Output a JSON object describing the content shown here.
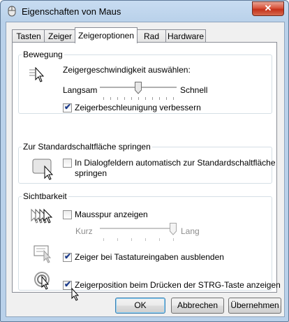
{
  "window": {
    "title": "Eigenschaften von Maus",
    "close_label": "✕"
  },
  "tabs": [
    {
      "label": "Tasten",
      "active": false
    },
    {
      "label": "Zeiger",
      "active": false
    },
    {
      "label": "Zeigeroptionen",
      "active": true
    },
    {
      "label": "Rad",
      "active": false
    },
    {
      "label": "Hardware",
      "active": false
    }
  ],
  "movement": {
    "legend": "Bewegung",
    "speed_label": "Zeigergeschwindigkeit auswählen:",
    "slow_label": "Langsam",
    "fast_label": "Schnell",
    "speed_value": 0.5,
    "acceleration_label": "Zeigerbeschleunigung verbessern",
    "acceleration_checked": true
  },
  "snapto": {
    "legend": "Zur Standardschaltfläche springen",
    "label_line1": "In Dialogfeldern automatisch zur Standardschaltfläche",
    "label_line2": "springen",
    "checked": false
  },
  "visibility": {
    "legend": "Sichtbarkeit",
    "trails_label": "Mausspur anzeigen",
    "trails_checked": false,
    "short_label": "Kurz",
    "long_label": "Lang",
    "trail_length_value": 1.0,
    "hide_label": "Zeiger bei Tastatureingaben ausblenden",
    "hide_checked": true,
    "ctrl_label": "Zeigerposition beim Drücken der STRG-Taste anzeigen",
    "ctrl_checked": true
  },
  "buttons": {
    "ok": "OK",
    "cancel": "Abbrechen",
    "apply": "Übernehmen"
  },
  "check_glyph": "✔",
  "colors": {
    "titlebar": "#b9d1ea",
    "close": "#c4311a",
    "panel_border": "#898c95"
  }
}
